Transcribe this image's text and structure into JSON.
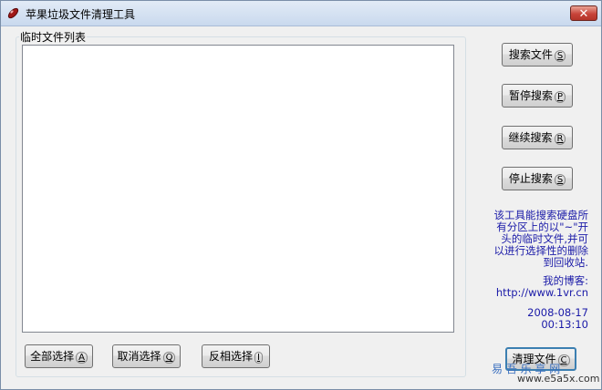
{
  "window": {
    "title": "苹果垃圾文件清理工具",
    "close_symbol": "✕"
  },
  "list_group": {
    "label": "临时文件列表"
  },
  "buttons": {
    "search": {
      "label": "搜索文件",
      "key": "S"
    },
    "pause": {
      "label": "暂停搜索",
      "key": "P"
    },
    "resume": {
      "label": "继续搜索",
      "key": "R"
    },
    "stop": {
      "label": "停止搜索",
      "key": "S"
    },
    "select_all": {
      "label": "全部选择",
      "key": "A"
    },
    "deselect": {
      "label": "取消选择",
      "key": "Q"
    },
    "invert": {
      "label": "反相选择",
      "key": "I"
    },
    "clean": {
      "label": "清理文件",
      "key": "C"
    }
  },
  "info": {
    "description": [
      "该工具能搜索硬盘所",
      "有分区上的以\"~\"开",
      "头的临时文件,并可",
      "以进行选择性的删除",
      "到回收站."
    ],
    "blog_label": "我的博客:",
    "blog_url": "http://www.1vr.cn",
    "date": "2008-08-17",
    "time": "00:13:10"
  },
  "watermark": {
    "line1": "易 吾 乐 享 网",
    "line2": "www.e5a5x.com"
  }
}
